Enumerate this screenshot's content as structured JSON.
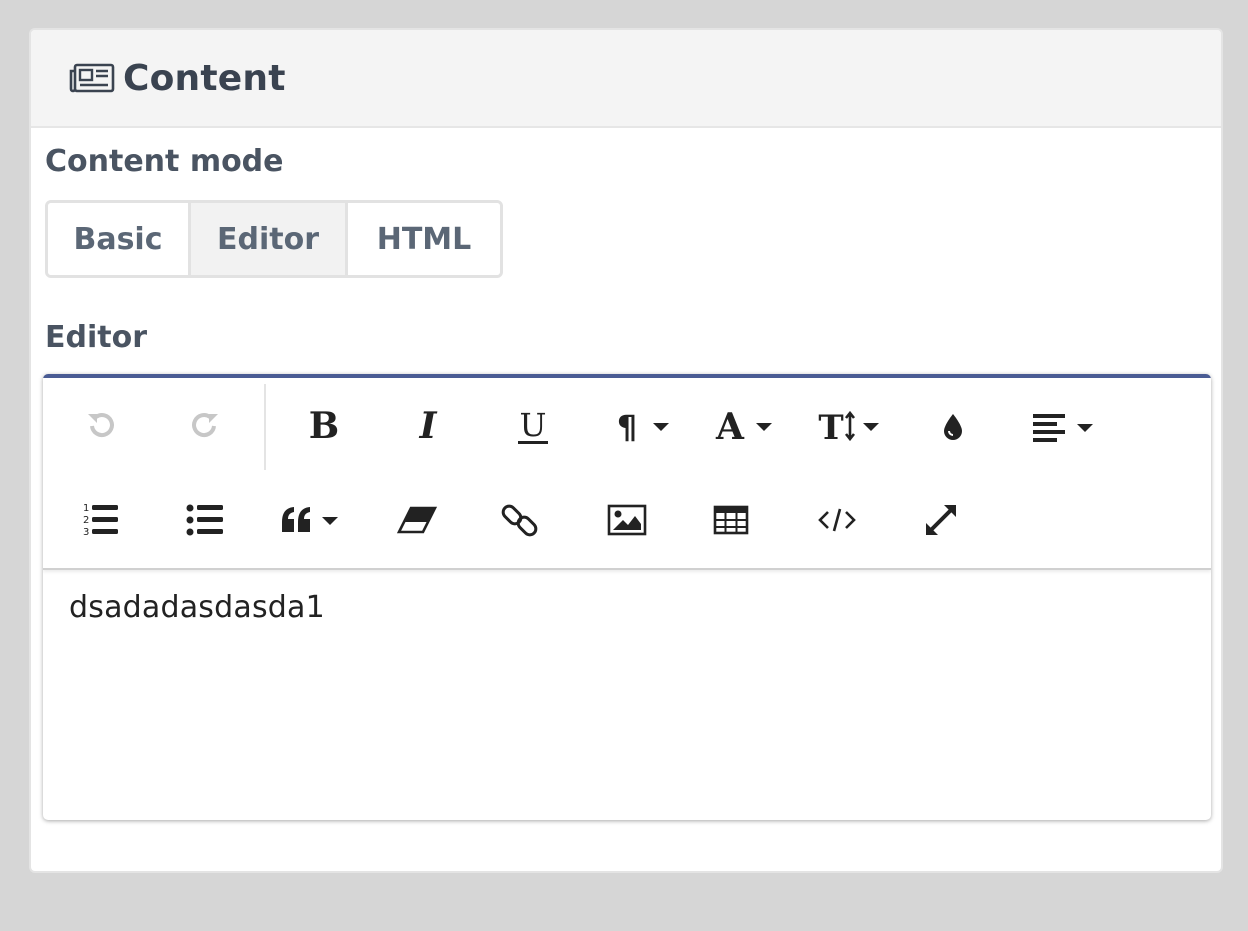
{
  "panel": {
    "title": "Content",
    "icon": "newspaper-icon"
  },
  "content_mode": {
    "label": "Content mode",
    "options": [
      "Basic",
      "Editor",
      "HTML"
    ],
    "selected": "Editor"
  },
  "editor": {
    "label": "Editor",
    "accent_color": "#4a5c94",
    "toolbar_icons": [
      "undo-icon",
      "redo-icon",
      "bold-icon",
      "italic-icon",
      "underline-icon",
      "paragraph-style-icon",
      "font-color-icon",
      "font-size-icon",
      "color-fill-icon",
      "align-icon",
      "ordered-list-icon",
      "unordered-list-icon",
      "quote-icon",
      "eraser-icon",
      "link-icon",
      "image-icon",
      "table-icon",
      "code-view-icon",
      "fullscreen-icon"
    ],
    "content": "dsadadasdasda1"
  }
}
